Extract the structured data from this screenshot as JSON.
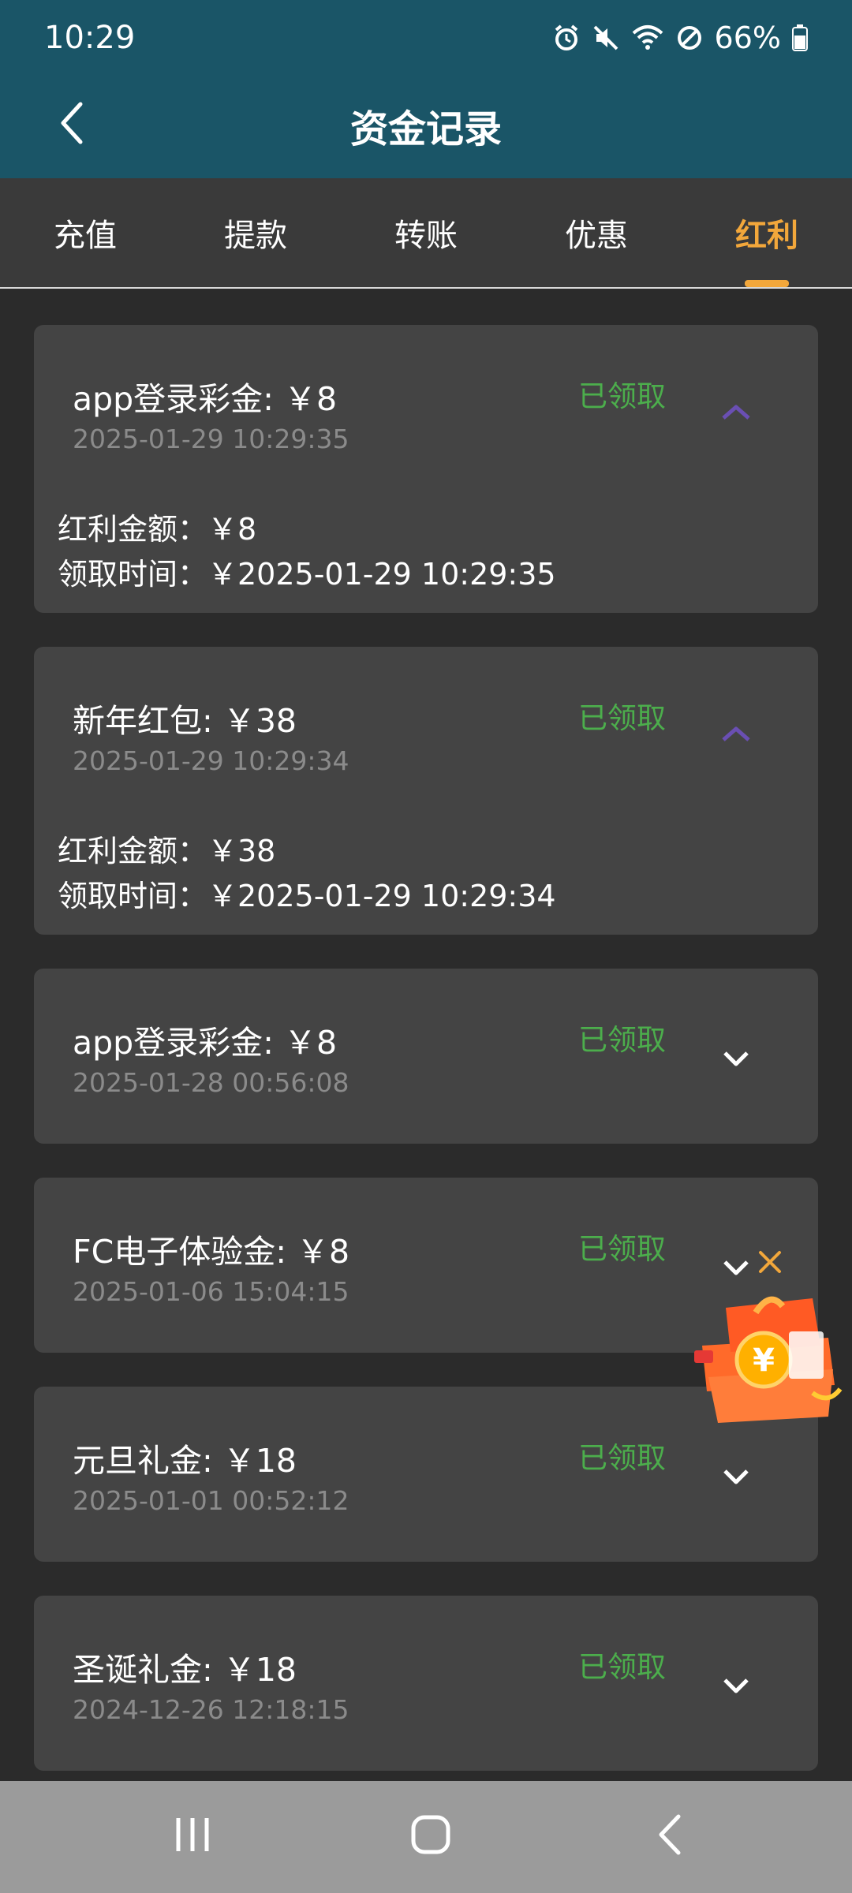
{
  "status_bar": {
    "time": "10:29",
    "battery": "66%",
    "icons": [
      "alarm-icon",
      "mute-icon",
      "wifi-icon",
      "blocked-icon",
      "battery-icon"
    ]
  },
  "header": {
    "title": "资金记录",
    "back_icon": "chevron-left-icon"
  },
  "tabs": [
    {
      "label": "充值",
      "active": false
    },
    {
      "label": "提款",
      "active": false
    },
    {
      "label": "转账",
      "active": false
    },
    {
      "label": "优惠",
      "active": false
    },
    {
      "label": "红利",
      "active": true
    }
  ],
  "records": [
    {
      "title": "app登录彩金: ￥8",
      "date": "2025-01-29 10:29:35",
      "status": "已领取",
      "expanded": true,
      "amount_line": "红利金额：￥8",
      "time_line": "领取时间：￥2025-01-29 10:29:35"
    },
    {
      "title": "新年红包: ￥38",
      "date": "2025-01-29 10:29:34",
      "status": "已领取",
      "expanded": true,
      "amount_line": "红利金额：￥38",
      "time_line": "领取时间：￥2025-01-29 10:29:34"
    },
    {
      "title": "app登录彩金: ￥8",
      "date": "2025-01-28 00:56:08",
      "status": "已领取",
      "expanded": false
    },
    {
      "title": "FC电子体验金: ￥8",
      "date": "2025-01-06 15:04:15",
      "status": "已领取",
      "expanded": false
    },
    {
      "title": "元旦礼金: ￥18",
      "date": "2025-01-01 00:52:12",
      "status": "已领取",
      "expanded": false
    },
    {
      "title": "圣诞礼金: ￥18",
      "date": "2024-12-26 12:18:15",
      "status": "已领取",
      "expanded": false
    }
  ],
  "colors": {
    "header_bg": "#1a5567",
    "active_tab": "#f2a73b",
    "status_green": "#4cae4c",
    "expanded_chevron": "#6a4fb3",
    "card_bg": "#444444",
    "page_bg": "#2b2b2b"
  },
  "floating_promo": {
    "icon": "gift-box-icon",
    "close_icon": "close-icon"
  },
  "nav_bar": {
    "icons": [
      "recent-apps-icon",
      "home-icon",
      "back-icon"
    ]
  }
}
